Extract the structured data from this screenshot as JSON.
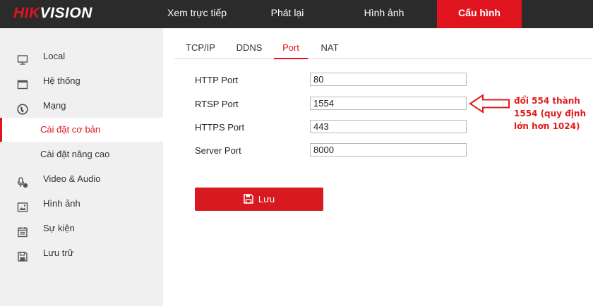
{
  "header": {
    "logo_red": "HIK",
    "logo_white": "VISION",
    "nav": [
      "Xem trực tiếp",
      "Phát lại",
      "Hình ảnh",
      "Cấu hình"
    ],
    "active_nav": "Cấu hình",
    "accent_color": "#e0141e"
  },
  "sidebar": {
    "items": [
      {
        "label": "Local",
        "icon": "monitor-icon"
      },
      {
        "label": "Hệ thống",
        "icon": "window-icon"
      },
      {
        "label": "Mạng",
        "icon": "globe-icon"
      },
      {
        "label": "Cài đặt cơ bản",
        "icon": ""
      },
      {
        "label": "Cài đặt nâng cao",
        "icon": ""
      },
      {
        "label": "Video & Audio",
        "icon": "microphone-icon"
      },
      {
        "label": "Hình ảnh",
        "icon": "image-icon"
      },
      {
        "label": "Sự kiện",
        "icon": "calendar-icon"
      },
      {
        "label": "Lưu trữ",
        "icon": "save-disk-icon"
      }
    ],
    "active_item": "Cài đặt cơ bản"
  },
  "tabs": {
    "items": [
      "TCP/IP",
      "DDNS",
      "Port",
      "NAT"
    ],
    "active": "Port"
  },
  "form": {
    "rows": [
      {
        "label": "HTTP Port",
        "value": "80"
      },
      {
        "label": "RTSP Port",
        "value": "1554"
      },
      {
        "label": "HTTPS Port",
        "value": "443"
      },
      {
        "label": "Server Port",
        "value": "8000"
      }
    ],
    "save_label": "Lưu"
  },
  "annotation": {
    "lines": [
      "đổi 554 thành",
      "1554 (quy định",
      "lớn hơn 1024)"
    ],
    "color": "#e01b1b"
  }
}
